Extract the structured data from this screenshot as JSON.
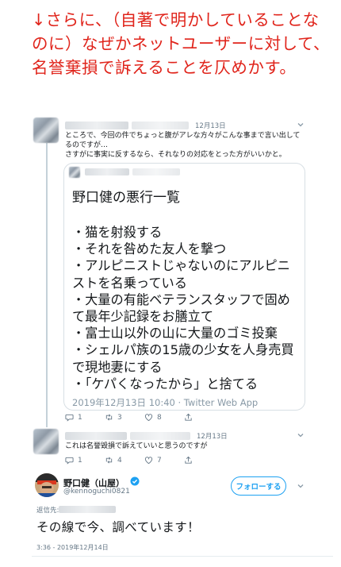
{
  "headline": "↓さらに、（自著で明かしていることなのに）なぜかネットユーザーに対して、名誉棄損で訴えることを仄めかす。",
  "tweet1": {
    "date": "12月13日",
    "text": "ところで、今回の件でちょっと腹がアレな方々がこんな事まで言い出してるのですが…\nさすがに事実に反するなら、それなりの対応をとった方がいいかと。",
    "quote": {
      "title": "野口健の悪行一覧",
      "items": "・猫を射殺する\n・それを咎めた友人を撃つ\n・アルピニストじゃないのにアルピニストを名乗っている\n・大量の有能ベテランスタッフで固めて最年少記録をお膳立て\n・富士山以外の山に大量のゴミ投棄\n・シェルパ族の15歳の少女を人身売買で現地妻にする\n・「ケパくなったから」と捨てる",
      "footer_date": "2019年12月13日 10:40 · ",
      "footer_via": "Twitter Web App"
    },
    "actions": {
      "replies": "1",
      "retweets": "3",
      "likes": "8"
    }
  },
  "tweet2": {
    "date": "12月13日",
    "text": "これは名誉毀損で訴えていいと思うのですが",
    "actions": {
      "replies": "1",
      "retweets": "4",
      "likes": "7"
    }
  },
  "main_tweet": {
    "name": "野口健（山屋）",
    "handle": "@kennoguchi0821",
    "follow_label": "フォローする",
    "reply_to_label": "返信先:",
    "text": "その線で今、調べています！",
    "timestamp": "3:36 - 2019年12月14日"
  },
  "colors": {
    "headline": "#e0241b",
    "accent": "#1da1f2",
    "muted": "#657786"
  }
}
